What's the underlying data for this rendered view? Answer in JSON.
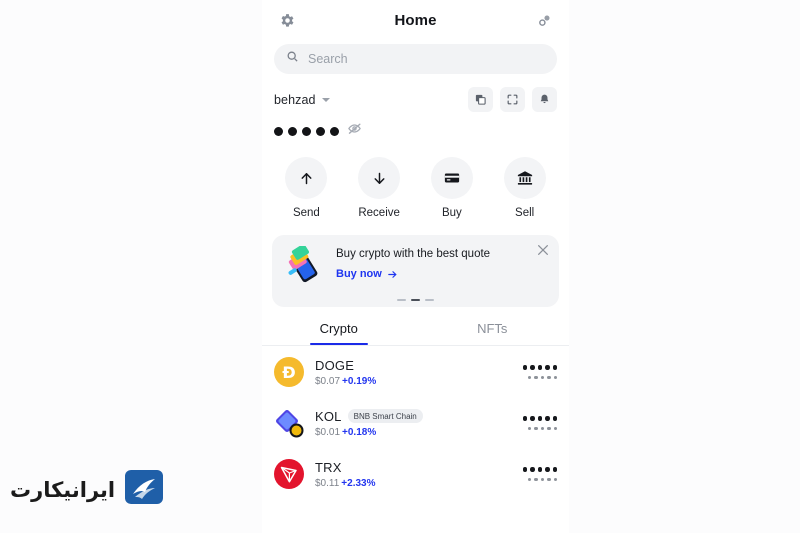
{
  "header": {
    "title": "Home",
    "settings_icon": "gear-icon",
    "link_icon": "link-connect-icon"
  },
  "search": {
    "placeholder": "Search",
    "value": "",
    "icon": "search-icon"
  },
  "account": {
    "name": "behzad",
    "caret_icon": "chevron-down-icon",
    "actions": [
      {
        "name": "copy-address-button",
        "icon": "copy-icon"
      },
      {
        "name": "scan-qr-button",
        "icon": "scan-icon"
      },
      {
        "name": "notifications-button",
        "icon": "bell-icon"
      }
    ],
    "balance_hidden": true,
    "balance_dot_count": 5,
    "visibility_icon": "eye-slash-icon"
  },
  "quick_actions": [
    {
      "label": "Send",
      "icon": "arrow-up-icon"
    },
    {
      "label": "Receive",
      "icon": "arrow-down-icon"
    },
    {
      "label": "Buy",
      "icon": "credit-card-icon"
    },
    {
      "label": "Sell",
      "icon": "bank-icon"
    }
  ],
  "banner": {
    "title": "Buy crypto with the best quote",
    "link_label": "Buy now",
    "link_arrow": "arrow-right-icon",
    "close_icon": "close-icon",
    "art_icon": "phone-cards-illustration",
    "carousel_total": 3,
    "carousel_active_index": 1
  },
  "tabs": [
    {
      "label": "Crypto",
      "active": true
    },
    {
      "label": "NFTs",
      "active": false
    }
  ],
  "tokens": [
    {
      "symbol": "DOGE",
      "chain": "",
      "price": "$0.07",
      "change": "+0.19%",
      "icon": "doge-icon",
      "balance_hidden": true
    },
    {
      "symbol": "KOL",
      "chain": "BNB Smart Chain",
      "price": "$0.01",
      "change": "+0.18%",
      "icon": "kol-icon",
      "balance_hidden": true
    },
    {
      "symbol": "TRX",
      "chain": "",
      "price": "$0.11",
      "change": "+2.33%",
      "icon": "trx-icon",
      "balance_hidden": true
    }
  ],
  "watermark": {
    "text": "ایرانیکارت",
    "logo_icon": "iranicard-logo",
    "color": "#1f5fa8"
  },
  "colors": {
    "accent_blue": "#1e35f0",
    "positive": "#2336ef",
    "surface": "#f3f4f6",
    "page": "#ffffff"
  }
}
